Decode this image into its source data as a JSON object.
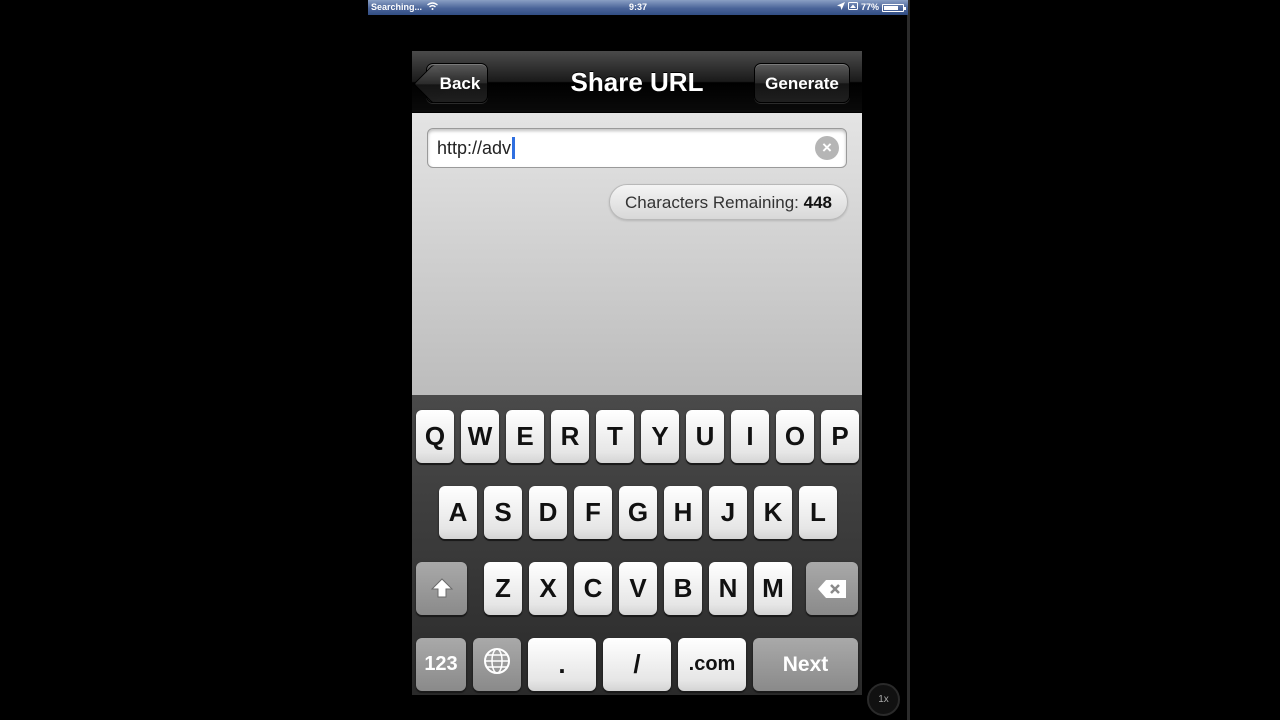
{
  "status_bar": {
    "carrier": "Searching...",
    "time": "9:37",
    "battery": "77%",
    "battery_level": 0.77,
    "bar_color": "#4a6499"
  },
  "navbar": {
    "back_label": "Back",
    "title": "Share URL",
    "generate_label": "Generate"
  },
  "url_input": {
    "value": "http://adv",
    "clear_icon": "clear-circle-icon"
  },
  "counter": {
    "label": "Characters Remaining:",
    "value": "448"
  },
  "keyboard": {
    "row1": [
      "Q",
      "W",
      "E",
      "R",
      "T",
      "Y",
      "U",
      "I",
      "O",
      "P"
    ],
    "row2": [
      "A",
      "S",
      "D",
      "F",
      "G",
      "H",
      "J",
      "K",
      "L"
    ],
    "row3": [
      "Z",
      "X",
      "C",
      "V",
      "B",
      "N",
      "M"
    ],
    "row4": {
      "numbers": "123",
      "globe": "globe-icon",
      "dot": ".",
      "slash": "/",
      "dotcom": ".com",
      "next": "Next"
    },
    "shift_icon": "shift-arrow-icon",
    "delete_icon": "backspace-icon"
  },
  "zoom_badge": "1x"
}
